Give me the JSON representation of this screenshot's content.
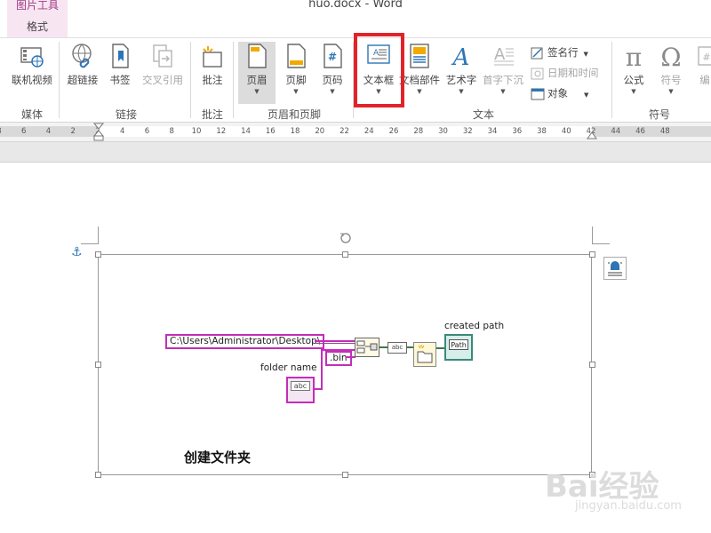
{
  "titlebar": {
    "contextual_tab_title": "图片工具",
    "contextual_tab_format": "格式",
    "document_title": "huo.docx - Word"
  },
  "ribbon": {
    "groups": [
      {
        "label": "媒体",
        "buttons": [
          {
            "label": "联机视频",
            "icon": "online-video-icon"
          }
        ]
      },
      {
        "label": "链接",
        "buttons": [
          {
            "label": "超链接",
            "icon": "hyperlink-icon"
          },
          {
            "label": "书签",
            "icon": "bookmark-icon"
          },
          {
            "label": "交叉引用",
            "icon": "cross-reference-icon",
            "disabled": true
          }
        ]
      },
      {
        "label": "批注",
        "buttons": [
          {
            "label": "批注",
            "icon": "comment-icon"
          }
        ]
      },
      {
        "label": "页眉和页脚",
        "buttons": [
          {
            "label": "页眉",
            "icon": "header-icon",
            "active": true
          },
          {
            "label": "页脚",
            "icon": "footer-icon"
          },
          {
            "label": "页码",
            "icon": "page-number-icon"
          }
        ]
      },
      {
        "label": "文本",
        "buttons": [
          {
            "label": "文本框",
            "icon": "text-box-icon",
            "highlighted": true
          },
          {
            "label": "文档部件",
            "icon": "quick-parts-icon"
          },
          {
            "label": "艺术字",
            "icon": "wordart-icon"
          },
          {
            "label": "首字下沉",
            "icon": "drop-cap-icon",
            "disabled": true
          }
        ],
        "small_buttons": [
          {
            "label": "签名行",
            "icon": "signature-line-icon"
          },
          {
            "label": "日期和时间",
            "icon": "date-time-icon",
            "disabled": true
          },
          {
            "label": "对象",
            "icon": "object-icon"
          }
        ]
      },
      {
        "label": "符号",
        "buttons": [
          {
            "label": "公式",
            "icon": "equation-icon"
          },
          {
            "label": "符号",
            "icon": "symbol-icon",
            "disabled": true
          },
          {
            "label": "编",
            "icon": "numbering-icon",
            "disabled": true
          }
        ]
      }
    ],
    "highlight_color": "#e0242a"
  },
  "ruler": {
    "ticks": [
      "8",
      "6",
      "4",
      "2",
      "2",
      "4",
      "6",
      "8",
      "10",
      "12",
      "14",
      "16",
      "18",
      "20",
      "22",
      "24",
      "26",
      "28",
      "30",
      "32",
      "34",
      "36",
      "38",
      "40",
      "42",
      "44",
      "46",
      "48"
    ]
  },
  "document": {
    "caption": "创建文件夹",
    "diagram": {
      "path_constant": "C:\\Users\\Administrator\\Desktop\\",
      "extension_constant": ".bin",
      "folder_name_label": "folder name",
      "folder_name_terminal": "abc",
      "created_path_label": "created path",
      "created_path_indicator": "Path",
      "build_string_token": "abc",
      "wire_color": "#c22eb8"
    }
  },
  "watermark": {
    "brand": "Bai经验",
    "url": "jingyan.baidu.com"
  }
}
